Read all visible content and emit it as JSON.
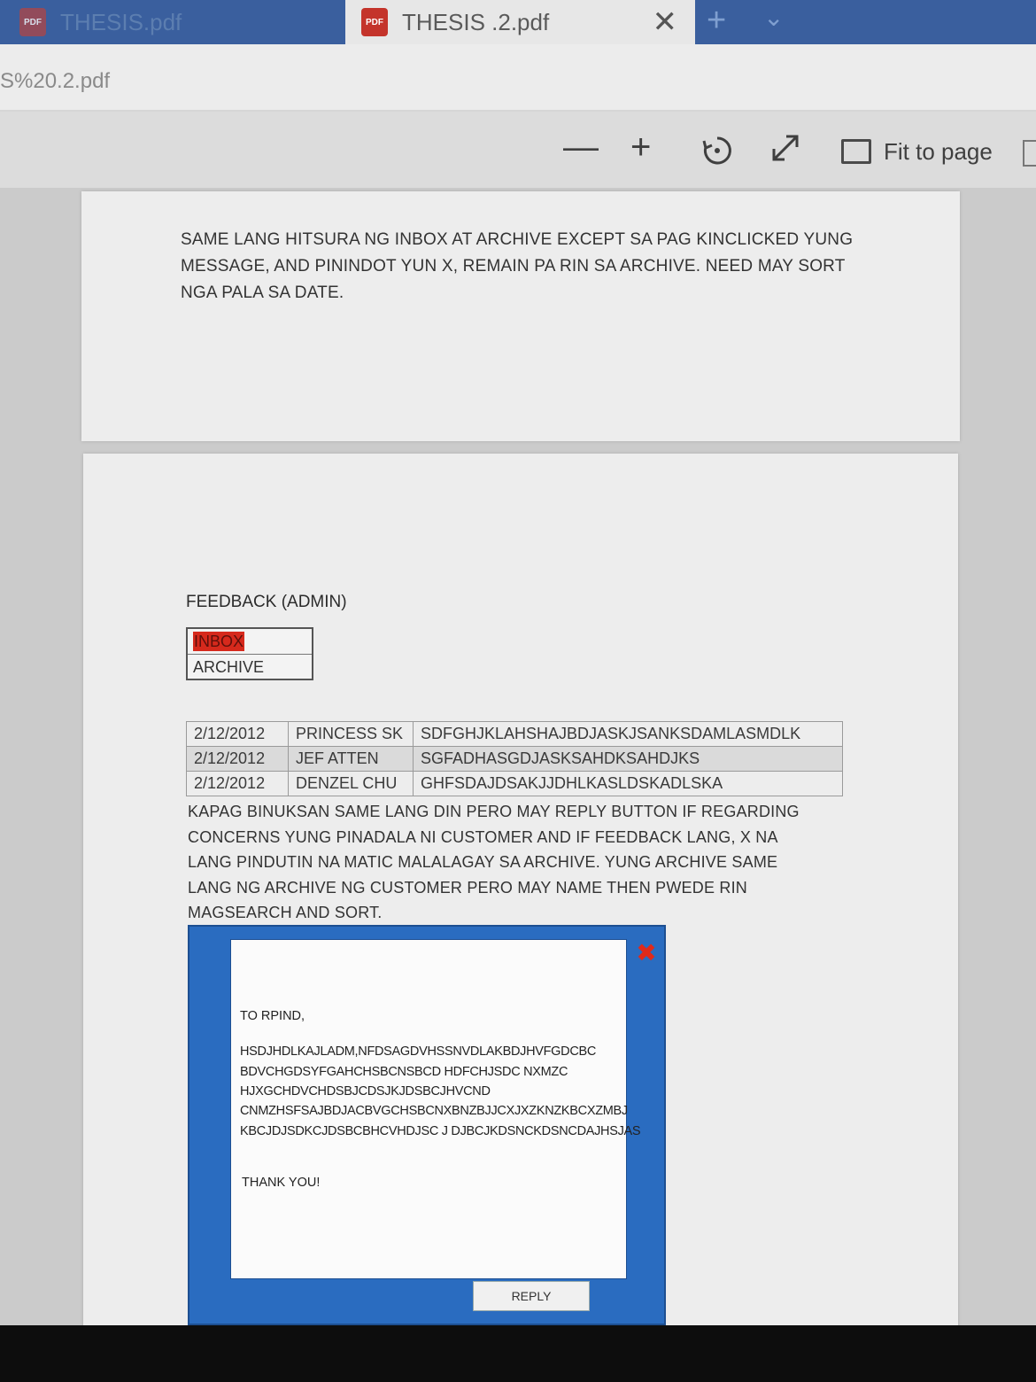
{
  "browser": {
    "tabs": [
      {
        "label": "THESIS.pdf",
        "active": false,
        "icon": "pdf-icon"
      },
      {
        "label": "THESIS .2.pdf",
        "active": true,
        "icon": "pdf-icon"
      }
    ],
    "address": "S%20.2.pdf",
    "accent_color": "#3a5f9e"
  },
  "toolbar": {
    "zoom_out_label": "—",
    "zoom_in_label": "+",
    "fit_to_page_label": "Fit to page"
  },
  "page1": {
    "note": "SAME LANG HITSURA NG INBOX AT ARCHIVE EXCEPT SA PAG KINCLICKED YUNG MESSAGE, AND PININDOT YUN X, REMAIN PA RIN SA ARCHIVE. NEED MAY SORT NGA PALA SA DATE."
  },
  "page2": {
    "heading": "FEEDBACK (ADMIN)",
    "folders": [
      "INBOX",
      "ARCHIVE"
    ],
    "messages": [
      {
        "date": "2/12/2012",
        "name": "PRINCESS SK",
        "preview": "SDFGHJKLAHSHAJBDJASKJSANKSDAMLASMDLK"
      },
      {
        "date": "2/12/2012",
        "name": "JEF ATTEN",
        "preview": "SGFADHASGDJASKSAHDKSAHDJKS"
      },
      {
        "date": "2/12/2012",
        "name": "DENZEL CHU",
        "preview": "GHFSDAJDSAKJJDHLKASLDSKADLSKA"
      }
    ],
    "note": "KAPAG BINUKSAN SAME LANG DIN PERO MAY REPLY BUTTON IF REGARDING CONCERNS YUNG PINADALA NI CUSTOMER AND IF FEEDBACK LANG, X NA LANG PINDUTIN NA MATIC MALALAGAY SA ARCHIVE. YUNG ARCHIVE SAME LANG NG ARCHIVE NG CUSTOMER PERO MAY NAME THEN PWEDE RIN MAGSEARCH AND SORT.",
    "dialog": {
      "greeting": "TO RPIND,",
      "body_lines": [
        "HSDJHDLKAJLADM,NFDSAGDVHSSNVDLAKBDJHVFGDCBC",
        "BDVCHGDSYFGAHCHSBCNSBCD HDFCHJSDC NXMZC",
        "HJXGCHDVCHDSBJCDSJKJDSBCJHVCND",
        "CNMZHSFSAJBDJACBVGCHSBCNXBNZBJJCXJXZKNZKBCXZMBJ",
        "KBCJDJSDKCJDSBCBHCVHDJSC J DJBCJKDSNCKDSNCDAJHSJAS"
      ],
      "closing": "THANK YOU!",
      "reply_label": "REPLY",
      "frame_color": "#2a6cc0",
      "close_color": "#e02a1a"
    }
  }
}
